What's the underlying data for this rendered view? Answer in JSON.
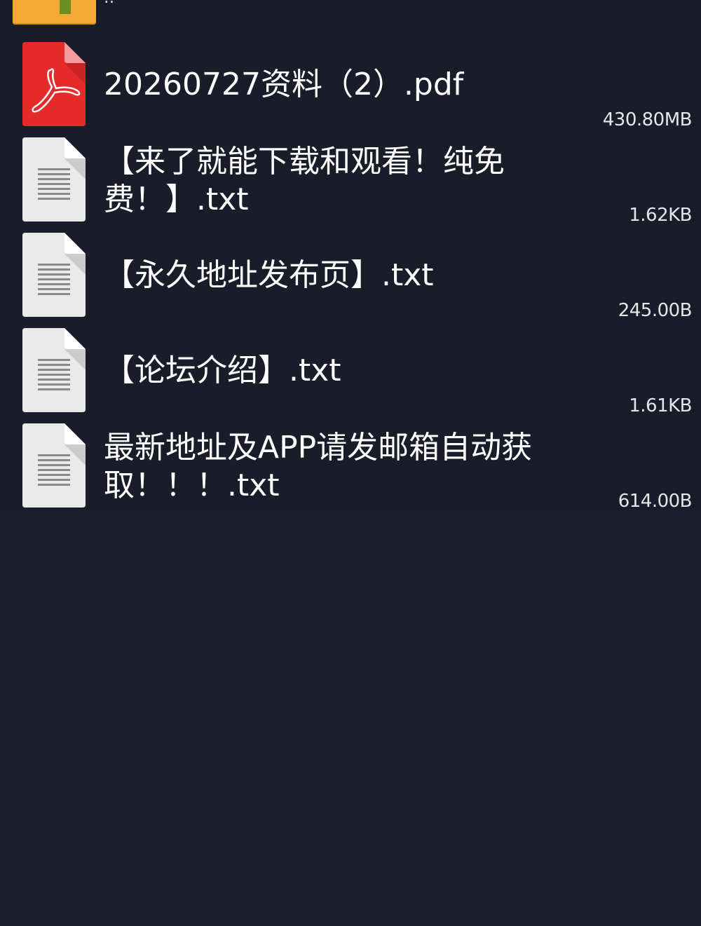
{
  "partial_item": {
    "name": "..",
    "icon": "folder-icon"
  },
  "files": [
    {
      "name": "20260727资料（2）.pdf",
      "size": "430.80MB",
      "icon": "pdf-icon"
    },
    {
      "name": "【来了就能下载和观看！纯免费！】.txt",
      "size": "1.62KB",
      "icon": "text-file-icon"
    },
    {
      "name": "【永久地址发布页】.txt",
      "size": "245.00B",
      "icon": "text-file-icon"
    },
    {
      "name": "【论坛介绍】.txt",
      "size": "1.61KB",
      "icon": "text-file-icon"
    },
    {
      "name": "最新地址及APP请发邮箱自动获取！！！.txt",
      "size": "614.00B",
      "icon": "text-file-icon"
    }
  ],
  "colors": {
    "background": "#1c1e2b",
    "pdf_red": "#e52a2a",
    "folder_orange": "#f3a934",
    "doc_gray": "#eaeaea"
  }
}
